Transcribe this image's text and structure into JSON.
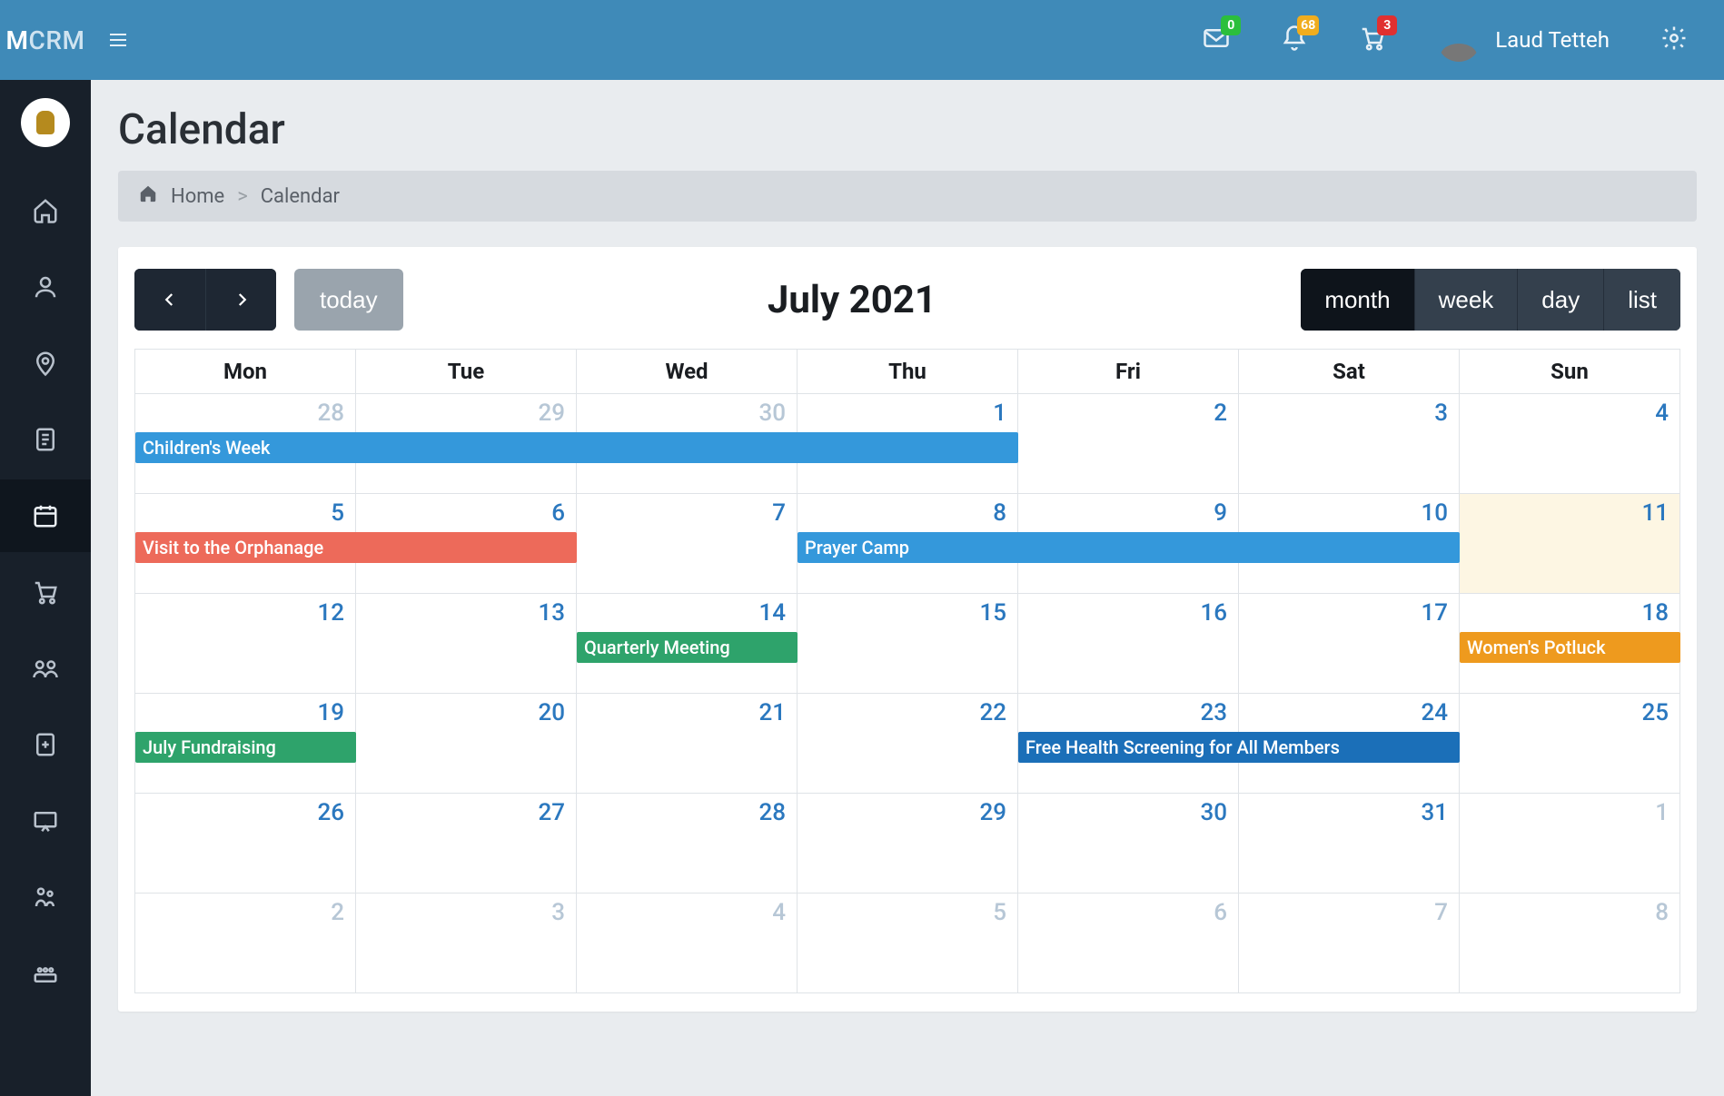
{
  "brand": {
    "prefix": "M",
    "suffix": "CRM"
  },
  "topbar": {
    "mail_badge": "0",
    "bell_badge": "68",
    "cart_badge": "3",
    "username": "Laud Tetteh"
  },
  "page": {
    "title": "Calendar",
    "breadcrumb_home": "Home",
    "breadcrumb_current": "Calendar"
  },
  "calendar": {
    "title": "July 2021",
    "today_label": "today",
    "views": {
      "month": "month",
      "week": "week",
      "day": "day",
      "list": "list"
    },
    "day_headers": [
      "Mon",
      "Tue",
      "Wed",
      "Thu",
      "Fri",
      "Sat",
      "Sun"
    ],
    "weeks": [
      [
        {
          "n": 28,
          "other": true
        },
        {
          "n": 29,
          "other": true
        },
        {
          "n": 30,
          "other": true
        },
        {
          "n": 1
        },
        {
          "n": 2
        },
        {
          "n": 3
        },
        {
          "n": 4
        }
      ],
      [
        {
          "n": 5
        },
        {
          "n": 6
        },
        {
          "n": 7
        },
        {
          "n": 8
        },
        {
          "n": 9
        },
        {
          "n": 10
        },
        {
          "n": 11,
          "today": true
        }
      ],
      [
        {
          "n": 12
        },
        {
          "n": 13
        },
        {
          "n": 14
        },
        {
          "n": 15
        },
        {
          "n": 16
        },
        {
          "n": 17
        },
        {
          "n": 18
        }
      ],
      [
        {
          "n": 19
        },
        {
          "n": 20
        },
        {
          "n": 21
        },
        {
          "n": 22
        },
        {
          "n": 23
        },
        {
          "n": 24
        },
        {
          "n": 25
        }
      ],
      [
        {
          "n": 26
        },
        {
          "n": 27
        },
        {
          "n": 28
        },
        {
          "n": 29
        },
        {
          "n": 30
        },
        {
          "n": 31
        },
        {
          "n": 1,
          "other": true
        }
      ],
      [
        {
          "n": 2,
          "other": true
        },
        {
          "n": 3,
          "other": true
        },
        {
          "n": 4,
          "other": true
        },
        {
          "n": 5,
          "other": true
        },
        {
          "n": 6,
          "other": true
        },
        {
          "n": 7,
          "other": true
        },
        {
          "n": 8,
          "other": true
        }
      ]
    ],
    "events": [
      {
        "title": "Children's Week",
        "week": 0,
        "start": 0,
        "span": 4,
        "color": "blue"
      },
      {
        "title": "Visit to the Orphanage",
        "week": 1,
        "start": 0,
        "span": 2,
        "color": "red"
      },
      {
        "title": "Prayer Camp",
        "week": 1,
        "start": 3,
        "span": 3,
        "color": "blue"
      },
      {
        "title": "Quarterly Meeting",
        "week": 2,
        "start": 2,
        "span": 1,
        "color": "green"
      },
      {
        "title": "Women's Potluck",
        "week": 2,
        "start": 6,
        "span": 1,
        "color": "orange"
      },
      {
        "title": "July Fundraising",
        "week": 3,
        "start": 0,
        "span": 1,
        "color": "green"
      },
      {
        "title": "Free Health Screening for All Members",
        "week": 3,
        "start": 4,
        "span": 2,
        "color": "dblue"
      }
    ]
  }
}
